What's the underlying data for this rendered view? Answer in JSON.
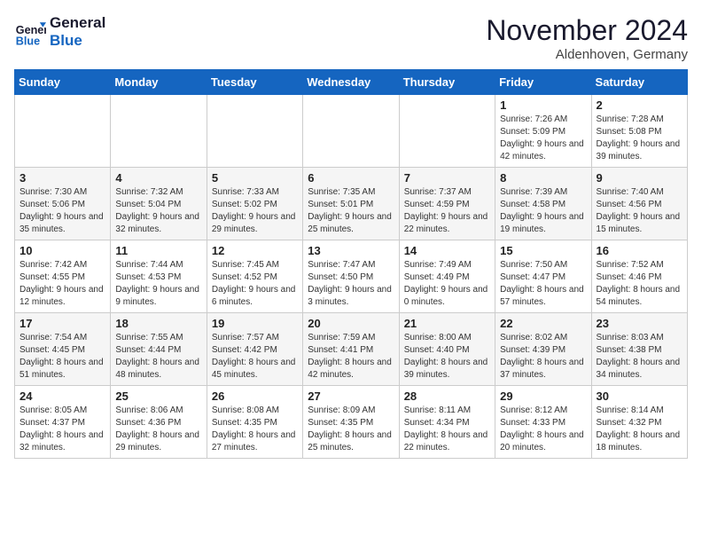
{
  "header": {
    "logo_line1": "General",
    "logo_line2": "Blue",
    "month_title": "November 2024",
    "subtitle": "Aldenhoven, Germany"
  },
  "weekdays": [
    "Sunday",
    "Monday",
    "Tuesday",
    "Wednesday",
    "Thursday",
    "Friday",
    "Saturday"
  ],
  "weeks": [
    [
      {
        "day": "",
        "info": ""
      },
      {
        "day": "",
        "info": ""
      },
      {
        "day": "",
        "info": ""
      },
      {
        "day": "",
        "info": ""
      },
      {
        "day": "",
        "info": ""
      },
      {
        "day": "1",
        "info": "Sunrise: 7:26 AM\nSunset: 5:09 PM\nDaylight: 9 hours and 42 minutes."
      },
      {
        "day": "2",
        "info": "Sunrise: 7:28 AM\nSunset: 5:08 PM\nDaylight: 9 hours and 39 minutes."
      }
    ],
    [
      {
        "day": "3",
        "info": "Sunrise: 7:30 AM\nSunset: 5:06 PM\nDaylight: 9 hours and 35 minutes."
      },
      {
        "day": "4",
        "info": "Sunrise: 7:32 AM\nSunset: 5:04 PM\nDaylight: 9 hours and 32 minutes."
      },
      {
        "day": "5",
        "info": "Sunrise: 7:33 AM\nSunset: 5:02 PM\nDaylight: 9 hours and 29 minutes."
      },
      {
        "day": "6",
        "info": "Sunrise: 7:35 AM\nSunset: 5:01 PM\nDaylight: 9 hours and 25 minutes."
      },
      {
        "day": "7",
        "info": "Sunrise: 7:37 AM\nSunset: 4:59 PM\nDaylight: 9 hours and 22 minutes."
      },
      {
        "day": "8",
        "info": "Sunrise: 7:39 AM\nSunset: 4:58 PM\nDaylight: 9 hours and 19 minutes."
      },
      {
        "day": "9",
        "info": "Sunrise: 7:40 AM\nSunset: 4:56 PM\nDaylight: 9 hours and 15 minutes."
      }
    ],
    [
      {
        "day": "10",
        "info": "Sunrise: 7:42 AM\nSunset: 4:55 PM\nDaylight: 9 hours and 12 minutes."
      },
      {
        "day": "11",
        "info": "Sunrise: 7:44 AM\nSunset: 4:53 PM\nDaylight: 9 hours and 9 minutes."
      },
      {
        "day": "12",
        "info": "Sunrise: 7:45 AM\nSunset: 4:52 PM\nDaylight: 9 hours and 6 minutes."
      },
      {
        "day": "13",
        "info": "Sunrise: 7:47 AM\nSunset: 4:50 PM\nDaylight: 9 hours and 3 minutes."
      },
      {
        "day": "14",
        "info": "Sunrise: 7:49 AM\nSunset: 4:49 PM\nDaylight: 9 hours and 0 minutes."
      },
      {
        "day": "15",
        "info": "Sunrise: 7:50 AM\nSunset: 4:47 PM\nDaylight: 8 hours and 57 minutes."
      },
      {
        "day": "16",
        "info": "Sunrise: 7:52 AM\nSunset: 4:46 PM\nDaylight: 8 hours and 54 minutes."
      }
    ],
    [
      {
        "day": "17",
        "info": "Sunrise: 7:54 AM\nSunset: 4:45 PM\nDaylight: 8 hours and 51 minutes."
      },
      {
        "day": "18",
        "info": "Sunrise: 7:55 AM\nSunset: 4:44 PM\nDaylight: 8 hours and 48 minutes."
      },
      {
        "day": "19",
        "info": "Sunrise: 7:57 AM\nSunset: 4:42 PM\nDaylight: 8 hours and 45 minutes."
      },
      {
        "day": "20",
        "info": "Sunrise: 7:59 AM\nSunset: 4:41 PM\nDaylight: 8 hours and 42 minutes."
      },
      {
        "day": "21",
        "info": "Sunrise: 8:00 AM\nSunset: 4:40 PM\nDaylight: 8 hours and 39 minutes."
      },
      {
        "day": "22",
        "info": "Sunrise: 8:02 AM\nSunset: 4:39 PM\nDaylight: 8 hours and 37 minutes."
      },
      {
        "day": "23",
        "info": "Sunrise: 8:03 AM\nSunset: 4:38 PM\nDaylight: 8 hours and 34 minutes."
      }
    ],
    [
      {
        "day": "24",
        "info": "Sunrise: 8:05 AM\nSunset: 4:37 PM\nDaylight: 8 hours and 32 minutes."
      },
      {
        "day": "25",
        "info": "Sunrise: 8:06 AM\nSunset: 4:36 PM\nDaylight: 8 hours and 29 minutes."
      },
      {
        "day": "26",
        "info": "Sunrise: 8:08 AM\nSunset: 4:35 PM\nDaylight: 8 hours and 27 minutes."
      },
      {
        "day": "27",
        "info": "Sunrise: 8:09 AM\nSunset: 4:35 PM\nDaylight: 8 hours and 25 minutes."
      },
      {
        "day": "28",
        "info": "Sunrise: 8:11 AM\nSunset: 4:34 PM\nDaylight: 8 hours and 22 minutes."
      },
      {
        "day": "29",
        "info": "Sunrise: 8:12 AM\nSunset: 4:33 PM\nDaylight: 8 hours and 20 minutes."
      },
      {
        "day": "30",
        "info": "Sunrise: 8:14 AM\nSunset: 4:32 PM\nDaylight: 8 hours and 18 minutes."
      }
    ]
  ]
}
